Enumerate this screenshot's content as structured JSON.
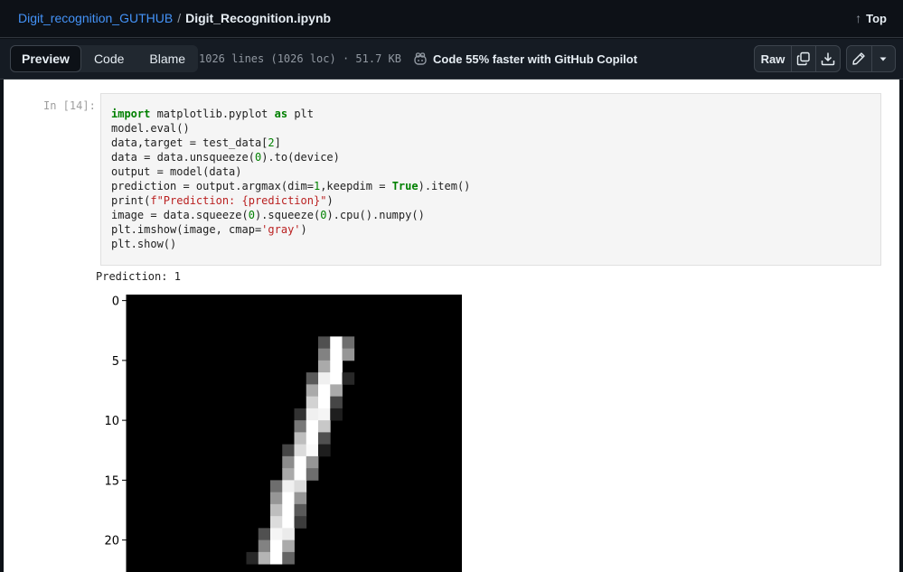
{
  "breadcrumb": {
    "repo": "Digit_recognition_GUTHUB",
    "separator": "/",
    "file": "Digit_Recognition.ipynb"
  },
  "top_link": {
    "label": "Top",
    "icon": "arrow-up-icon"
  },
  "toolbar": {
    "tabs": [
      {
        "label": "Preview",
        "active": true
      },
      {
        "label": "Code",
        "active": false
      },
      {
        "label": "Blame",
        "active": false
      }
    ],
    "file_info": "1026 lines (1026 loc) · 51.7 KB",
    "copilot_text": "Code 55% faster with GitHub Copilot",
    "raw_label": "Raw",
    "icons": [
      "copilot-icon",
      "copy-icon",
      "download-icon",
      "pencil-icon",
      "triangle-down-icon"
    ]
  },
  "cell": {
    "prompt": "In [14]:",
    "code_lines": [
      "import matplotlib.pyplot as plt",
      "model.eval()",
      "data,target = test_data[2]",
      "data = data.unsqueeze(0).to(device)",
      "output = model(data)",
      "prediction = output.argmax(dim=1,keepdim = True).item()",
      "print(f\"Prediction: {prediction}\")",
      "image = data.squeeze(0).squeeze(0).cpu().numpy()",
      "plt.imshow(image, cmap='gray')",
      "plt.show()"
    ],
    "output_text": "Prediction: 1"
  },
  "chart_data": {
    "type": "heatmap",
    "colormap": "gray",
    "title": "",
    "xlabel": "",
    "ylabel": "",
    "y_ticks": [
      0,
      5,
      10,
      15,
      20
    ],
    "x_ticks": [],
    "image_size": [
      28,
      28
    ],
    "visible_rows": [
      0,
      22
    ],
    "value_range": [
      0,
      255
    ],
    "nonzero_pixels": [
      [
        4,
        16,
        80
      ],
      [
        4,
        17,
        255
      ],
      [
        4,
        18,
        110
      ],
      [
        5,
        16,
        130
      ],
      [
        5,
        17,
        255
      ],
      [
        5,
        18,
        150
      ],
      [
        6,
        16,
        170
      ],
      [
        6,
        17,
        255
      ],
      [
        7,
        15,
        90
      ],
      [
        7,
        16,
        240
      ],
      [
        7,
        17,
        255
      ],
      [
        7,
        18,
        40
      ],
      [
        8,
        15,
        170
      ],
      [
        8,
        16,
        255
      ],
      [
        8,
        17,
        170
      ],
      [
        9,
        15,
        210
      ],
      [
        9,
        16,
        255
      ],
      [
        9,
        17,
        70
      ],
      [
        10,
        14,
        50
      ],
      [
        10,
        15,
        240
      ],
      [
        10,
        16,
        245
      ],
      [
        10,
        17,
        30
      ],
      [
        11,
        14,
        120
      ],
      [
        11,
        15,
        255
      ],
      [
        11,
        16,
        200
      ],
      [
        12,
        14,
        190
      ],
      [
        12,
        15,
        255
      ],
      [
        12,
        16,
        80
      ],
      [
        13,
        13,
        70
      ],
      [
        13,
        14,
        220
      ],
      [
        13,
        15,
        250
      ],
      [
        13,
        16,
        30
      ],
      [
        14,
        13,
        140
      ],
      [
        14,
        14,
        255
      ],
      [
        14,
        15,
        150
      ],
      [
        15,
        13,
        170
      ],
      [
        15,
        14,
        255
      ],
      [
        15,
        15,
        110
      ],
      [
        16,
        12,
        110
      ],
      [
        16,
        13,
        240
      ],
      [
        16,
        14,
        220
      ],
      [
        17,
        12,
        150
      ],
      [
        17,
        13,
        255
      ],
      [
        17,
        14,
        150
      ],
      [
        18,
        12,
        190
      ],
      [
        18,
        13,
        255
      ],
      [
        18,
        14,
        90
      ],
      [
        19,
        12,
        220
      ],
      [
        19,
        13,
        255
      ],
      [
        19,
        14,
        60
      ],
      [
        20,
        11,
        80
      ],
      [
        20,
        12,
        245
      ],
      [
        20,
        13,
        235
      ],
      [
        21,
        11,
        130
      ],
      [
        21,
        12,
        255
      ],
      [
        21,
        13,
        170
      ],
      [
        22,
        10,
        40
      ],
      [
        22,
        11,
        180
      ],
      [
        22,
        12,
        255
      ],
      [
        22,
        13,
        100
      ]
    ]
  }
}
